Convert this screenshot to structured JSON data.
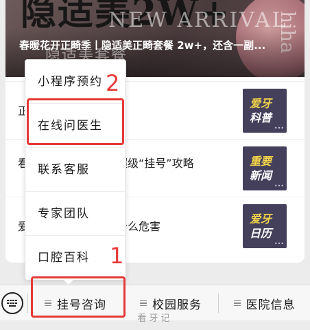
{
  "banner": {
    "big_text": "隐适美2W+",
    "arrival_text": "NEW ARRIVAL",
    "side_text": "hiha",
    "headline": "春暖花开正畸季丨隐适美正畸套餐 2w+，还含一副...",
    "faded_text": "隐适美套餐"
  },
  "articles": [
    {
      "title": "正畸过程中常见问题",
      "thumb_line1": "爱牙",
      "thumb_line2": "科普"
    },
    {
      "title": "看诊前，请收好这份超级“挂号”攻略",
      "thumb_line1": "重要",
      "thumb_line2": "新闻"
    },
    {
      "title": "爱牙日，口腔问题有什么危害",
      "thumb_line1": "爱牙",
      "thumb_line2": "日历"
    }
  ],
  "popup_menu": {
    "items": [
      {
        "label": "小程序预约"
      },
      {
        "label": "在线问医生"
      },
      {
        "label": "联系客服"
      },
      {
        "label": "专家团队"
      },
      {
        "label": "口腔百科"
      }
    ]
  },
  "annotations": {
    "step1": "1",
    "step2": "2"
  },
  "bottom_bar": {
    "tabs": [
      {
        "label": "挂号咨询"
      },
      {
        "label": "校园服务"
      },
      {
        "label": "医院信息"
      }
    ]
  },
  "watermark": "看牙记",
  "icons": {
    "keyboard": "keyboard-icon",
    "menu": "hamburger-icon",
    "thumb_more": "ellipsis-icon"
  },
  "colors": {
    "annotation_red": "#e53935",
    "thumb_bg": "#44405c",
    "thumb_yellow": "#f2d24a"
  }
}
